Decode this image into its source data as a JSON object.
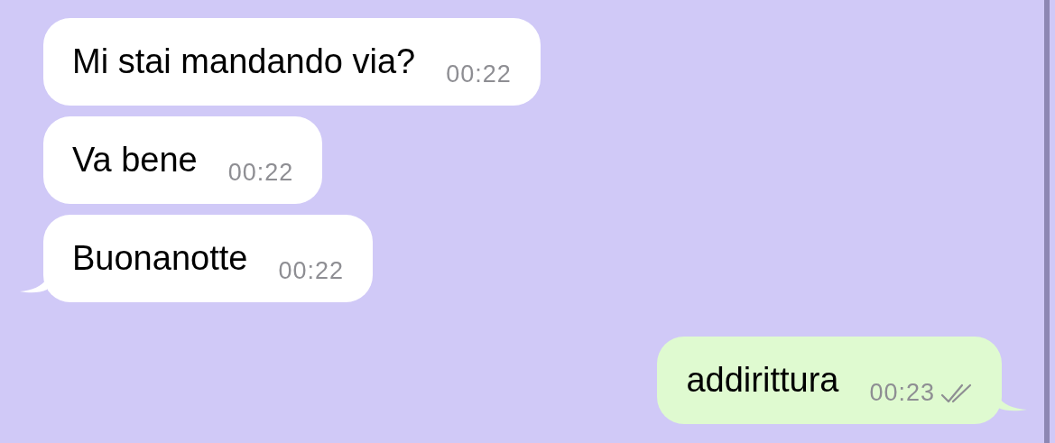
{
  "messages": [
    {
      "kind": "incoming",
      "text": "Mi stai mandando via?",
      "time": "00:22",
      "tail": false
    },
    {
      "kind": "incoming",
      "text": "Va bene",
      "time": "00:22",
      "tail": false
    },
    {
      "kind": "incoming",
      "text": "Buonanotte",
      "time": "00:22",
      "tail": true
    },
    {
      "kind": "outgoing",
      "text": "addirittura",
      "time": "00:23",
      "tail": true,
      "read": true
    }
  ]
}
